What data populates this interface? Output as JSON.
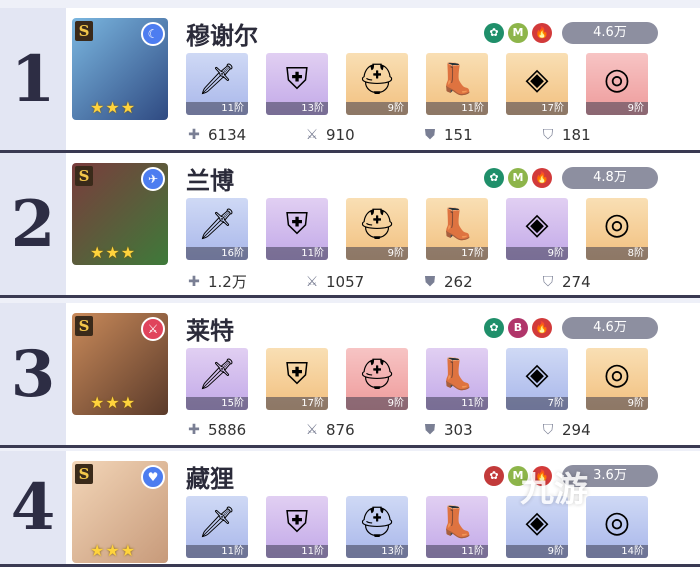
{
  "characters": [
    {
      "rank": "1",
      "grade": "S",
      "name": "穆谢尔",
      "element_icon": "moon-icon",
      "element_color": "#4d7df0",
      "badges": [
        {
          "icon": "swirl-icon",
          "color": "#1f8f6a",
          "text": ""
        },
        {
          "icon": "m-badge",
          "color": "#8db54a",
          "text": "M"
        },
        {
          "icon": "fire-icon",
          "color": "#d23a3a",
          "text": ""
        }
      ],
      "power": "4.6万",
      "items": [
        {
          "icon": "sword-icon",
          "bg": "blue",
          "tier": "11阶"
        },
        {
          "icon": "armor-icon",
          "bg": "purple",
          "tier": "13阶"
        },
        {
          "icon": "helmet-icon",
          "bg": "orange",
          "tier": "9阶"
        },
        {
          "icon": "boots-icon",
          "bg": "orange",
          "tier": "11阶"
        },
        {
          "icon": "amulet-icon",
          "bg": "orange",
          "tier": "17阶"
        },
        {
          "icon": "ring-icon",
          "bg": "red",
          "tier": "9阶"
        }
      ],
      "stats": [
        "6134",
        "910",
        "151",
        "181"
      ]
    },
    {
      "rank": "2",
      "grade": "S",
      "name": "兰博",
      "element_icon": "wind-icon",
      "element_color": "#4d7df0",
      "badges": [
        {
          "icon": "swirl-icon",
          "color": "#1f8f6a",
          "text": ""
        },
        {
          "icon": "m-badge",
          "color": "#8db54a",
          "text": "M"
        },
        {
          "icon": "fire-icon",
          "color": "#d23a3a",
          "text": ""
        }
      ],
      "power": "4.8万",
      "items": [
        {
          "icon": "sword-icon",
          "bg": "blue",
          "tier": "16阶"
        },
        {
          "icon": "armor-icon",
          "bg": "purple",
          "tier": "11阶"
        },
        {
          "icon": "helmet-icon",
          "bg": "orange",
          "tier": "9阶"
        },
        {
          "icon": "boots-icon",
          "bg": "orange",
          "tier": "17阶"
        },
        {
          "icon": "amulet-icon",
          "bg": "purple",
          "tier": "9阶"
        },
        {
          "icon": "ring-icon",
          "bg": "orange",
          "tier": "8阶"
        }
      ],
      "stats": [
        "1.2万",
        "1057",
        "262",
        "274"
      ]
    },
    {
      "rank": "3",
      "grade": "S",
      "name": "莱特",
      "element_icon": "slash-icon",
      "element_color": "#e0445c",
      "badges": [
        {
          "icon": "swirl-icon",
          "color": "#1f8f6a",
          "text": ""
        },
        {
          "icon": "b-badge",
          "color": "#b0356a",
          "text": "B"
        },
        {
          "icon": "fire-icon",
          "color": "#d23a3a",
          "text": ""
        }
      ],
      "power": "4.6万",
      "items": [
        {
          "icon": "sword-icon",
          "bg": "purple",
          "tier": "15阶"
        },
        {
          "icon": "armor-icon",
          "bg": "orange",
          "tier": "17阶"
        },
        {
          "icon": "helmet-icon",
          "bg": "red",
          "tier": "9阶"
        },
        {
          "icon": "boots-icon",
          "bg": "purple",
          "tier": "11阶"
        },
        {
          "icon": "amulet-icon",
          "bg": "blue",
          "tier": "7阶"
        },
        {
          "icon": "ring-icon",
          "bg": "orange",
          "tier": "9阶"
        }
      ],
      "stats": [
        "5886",
        "876",
        "303",
        "294"
      ]
    },
    {
      "rank": "4",
      "grade": "S",
      "name": "藏狸",
      "element_icon": "heart-icon",
      "element_color": "#4d7df0",
      "badges": [
        {
          "icon": "swirl-icon",
          "color": "#c23a3a",
          "text": ""
        },
        {
          "icon": "m-badge",
          "color": "#8db54a",
          "text": "M"
        },
        {
          "icon": "fire-icon",
          "color": "#d23a3a",
          "text": ""
        }
      ],
      "power": "3.6万",
      "items": [
        {
          "icon": "sword-icon",
          "bg": "blue",
          "tier": "11阶"
        },
        {
          "icon": "armor-icon",
          "bg": "purple",
          "tier": "11阶"
        },
        {
          "icon": "helmet-icon",
          "bg": "blue",
          "tier": "13阶"
        },
        {
          "icon": "boots-icon",
          "bg": "purple",
          "tier": "11阶"
        },
        {
          "icon": "amulet-icon",
          "bg": "blue",
          "tier": "9阶"
        },
        {
          "icon": "ring-icon",
          "bg": "blue",
          "tier": "14阶"
        }
      ],
      "stats": [
        "",
        "",
        "",
        ""
      ]
    }
  ],
  "watermark": "九游"
}
